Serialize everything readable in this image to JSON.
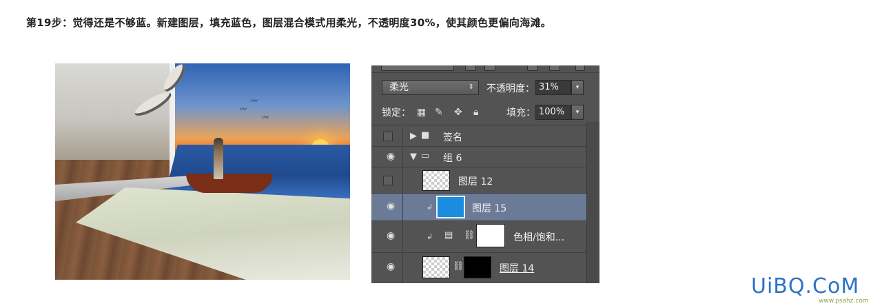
{
  "caption": "第19步：觉得还是不够蓝。新建图层，填充蓝色，图层混合模式用柔光，不透明度30%，使其颜色更偏向海滩。",
  "panel": {
    "blend_mode": "柔光",
    "opacity_label": "不透明度：",
    "opacity_value": "31%",
    "lock_label": "锁定：",
    "fill_label": "填充：",
    "fill_value": "100%",
    "layers": [
      {
        "name": "签名",
        "type": "group",
        "visible": false,
        "expanded": false
      },
      {
        "name": "组 6",
        "type": "group",
        "visible": true,
        "expanded": true
      },
      {
        "name": "图层 12",
        "type": "layer",
        "visible": false,
        "thumb": "transparent"
      },
      {
        "name": "图层 15",
        "type": "layer",
        "visible": true,
        "thumb": "#1a8de0",
        "selected": true,
        "clipped": true
      },
      {
        "name": "色相/饱和...",
        "type": "adjustment",
        "visible": true,
        "clipped": true
      },
      {
        "name": "图层 14",
        "type": "layer",
        "visible": true,
        "masked": true
      }
    ]
  },
  "colors": {
    "panel_bg": "#535353",
    "selected_row": "#6a7a97",
    "fill_blue": "#1a8de0",
    "watermark_blue": "#2b73c7"
  },
  "watermark": {
    "brand": "UiBQ.CoM",
    "site": "www.psahz.com"
  }
}
